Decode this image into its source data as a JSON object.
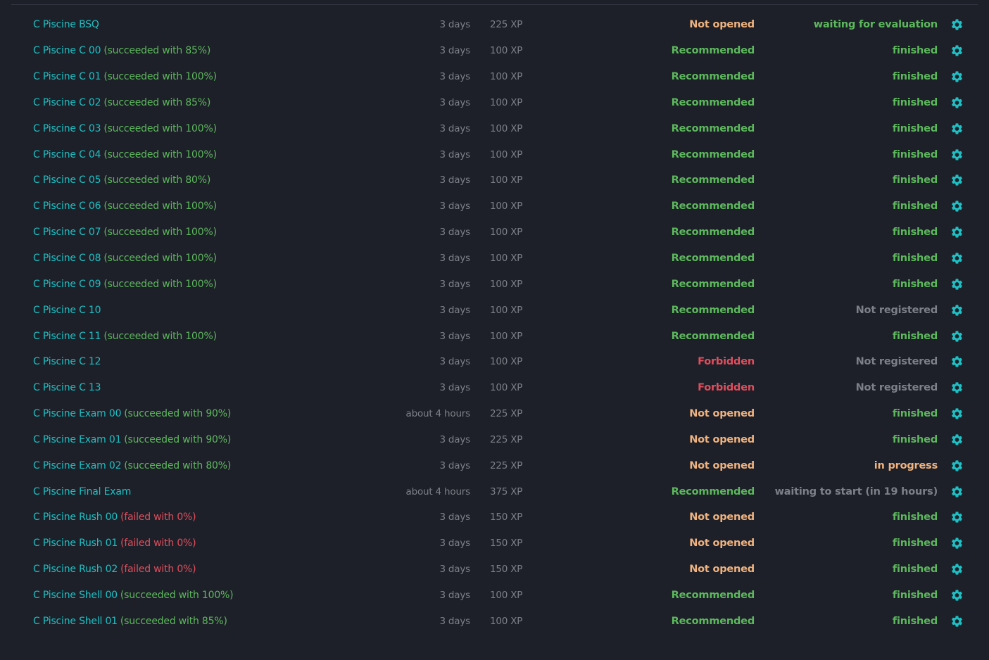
{
  "colors": {
    "background": "#1e2029",
    "link": "#1dc0c4",
    "success": "#5cb85c",
    "fail": "#e04e5c",
    "muted": "#7d8088",
    "not_opened": "#f0b37e",
    "recommended": "#5cb85c",
    "forbidden": "#e04e5c",
    "not_registered": "#7d8088",
    "in_progress": "#f0b37e",
    "waiting": "#7d8088"
  },
  "icons": {
    "settings": "gear-icon"
  },
  "projects": [
    {
      "name": "C Piscine BSQ",
      "result": "",
      "result_type": "none",
      "duration": "3 days",
      "xp": "225 XP",
      "availability": "Not opened",
      "availability_type": "not_opened",
      "status": "waiting for evaluation",
      "status_type": "success"
    },
    {
      "name": "C Piscine C 00",
      "result": "(succeeded with 85%)",
      "result_type": "success",
      "duration": "3 days",
      "xp": "100 XP",
      "availability": "Recommended",
      "availability_type": "recommended",
      "status": "finished",
      "status_type": "success"
    },
    {
      "name": "C Piscine C 01",
      "result": "(succeeded with 100%)",
      "result_type": "success",
      "duration": "3 days",
      "xp": "100 XP",
      "availability": "Recommended",
      "availability_type": "recommended",
      "status": "finished",
      "status_type": "success"
    },
    {
      "name": "C Piscine C 02",
      "result": "(succeeded with 85%)",
      "result_type": "success",
      "duration": "3 days",
      "xp": "100 XP",
      "availability": "Recommended",
      "availability_type": "recommended",
      "status": "finished",
      "status_type": "success"
    },
    {
      "name": "C Piscine C 03",
      "result": "(succeeded with 100%)",
      "result_type": "success",
      "duration": "3 days",
      "xp": "100 XP",
      "availability": "Recommended",
      "availability_type": "recommended",
      "status": "finished",
      "status_type": "success"
    },
    {
      "name": "C Piscine C 04",
      "result": "(succeeded with 100%)",
      "result_type": "success",
      "duration": "3 days",
      "xp": "100 XP",
      "availability": "Recommended",
      "availability_type": "recommended",
      "status": "finished",
      "status_type": "success"
    },
    {
      "name": "C Piscine C 05",
      "result": "(succeeded with 80%)",
      "result_type": "success",
      "duration": "3 days",
      "xp": "100 XP",
      "availability": "Recommended",
      "availability_type": "recommended",
      "status": "finished",
      "status_type": "success"
    },
    {
      "name": "C Piscine C 06",
      "result": "(succeeded with 100%)",
      "result_type": "success",
      "duration": "3 days",
      "xp": "100 XP",
      "availability": "Recommended",
      "availability_type": "recommended",
      "status": "finished",
      "status_type": "success"
    },
    {
      "name": "C Piscine C 07",
      "result": "(succeeded with 100%)",
      "result_type": "success",
      "duration": "3 days",
      "xp": "100 XP",
      "availability": "Recommended",
      "availability_type": "recommended",
      "status": "finished",
      "status_type": "success"
    },
    {
      "name": "C Piscine C 08",
      "result": "(succeeded with 100%)",
      "result_type": "success",
      "duration": "3 days",
      "xp": "100 XP",
      "availability": "Recommended",
      "availability_type": "recommended",
      "status": "finished",
      "status_type": "success"
    },
    {
      "name": "C Piscine C 09",
      "result": "(succeeded with 100%)",
      "result_type": "success",
      "duration": "3 days",
      "xp": "100 XP",
      "availability": "Recommended",
      "availability_type": "recommended",
      "status": "finished",
      "status_type": "success"
    },
    {
      "name": "C Piscine C 10",
      "result": "",
      "result_type": "none",
      "duration": "3 days",
      "xp": "100 XP",
      "availability": "Recommended",
      "availability_type": "recommended",
      "status": "Not registered",
      "status_type": "not_registered"
    },
    {
      "name": "C Piscine C 11",
      "result": "(succeeded with 100%)",
      "result_type": "success",
      "duration": "3 days",
      "xp": "100 XP",
      "availability": "Recommended",
      "availability_type": "recommended",
      "status": "finished",
      "status_type": "success"
    },
    {
      "name": "C Piscine C 12",
      "result": "",
      "result_type": "none",
      "duration": "3 days",
      "xp": "100 XP",
      "availability": "Forbidden",
      "availability_type": "forbidden",
      "status": "Not registered",
      "status_type": "not_registered"
    },
    {
      "name": "C Piscine C 13",
      "result": "",
      "result_type": "none",
      "duration": "3 days",
      "xp": "100 XP",
      "availability": "Forbidden",
      "availability_type": "forbidden",
      "status": "Not registered",
      "status_type": "not_registered"
    },
    {
      "name": "C Piscine Exam 00",
      "result": "(succeeded with 90%)",
      "result_type": "success",
      "duration": "about 4 hours",
      "xp": "225 XP",
      "availability": "Not opened",
      "availability_type": "not_opened",
      "status": "finished",
      "status_type": "success"
    },
    {
      "name": "C Piscine Exam 01",
      "result": "(succeeded with 90%)",
      "result_type": "success",
      "duration": "3 days",
      "xp": "225 XP",
      "availability": "Not opened",
      "availability_type": "not_opened",
      "status": "finished",
      "status_type": "success"
    },
    {
      "name": "C Piscine Exam 02",
      "result": "(succeeded with 80%)",
      "result_type": "success",
      "duration": "3 days",
      "xp": "225 XP",
      "availability": "Not opened",
      "availability_type": "not_opened",
      "status": "in progress",
      "status_type": "in_progress"
    },
    {
      "name": "C Piscine Final Exam",
      "result": "",
      "result_type": "none",
      "duration": "about 4 hours",
      "xp": "375 XP",
      "availability": "Recommended",
      "availability_type": "recommended",
      "status": "waiting to start (in 19 hours)",
      "status_type": "waiting"
    },
    {
      "name": "C Piscine Rush 00",
      "result": "(failed with 0%)",
      "result_type": "fail",
      "duration": "3 days",
      "xp": "150 XP",
      "availability": "Not opened",
      "availability_type": "not_opened",
      "status": "finished",
      "status_type": "success"
    },
    {
      "name": "C Piscine Rush 01",
      "result": "(failed with 0%)",
      "result_type": "fail",
      "duration": "3 days",
      "xp": "150 XP",
      "availability": "Not opened",
      "availability_type": "not_opened",
      "status": "finished",
      "status_type": "success"
    },
    {
      "name": "C Piscine Rush 02",
      "result": "(failed with 0%)",
      "result_type": "fail",
      "duration": "3 days",
      "xp": "150 XP",
      "availability": "Not opened",
      "availability_type": "not_opened",
      "status": "finished",
      "status_type": "success"
    },
    {
      "name": "C Piscine Shell 00",
      "result": "(succeeded with 100%)",
      "result_type": "success",
      "duration": "3 days",
      "xp": "100 XP",
      "availability": "Recommended",
      "availability_type": "recommended",
      "status": "finished",
      "status_type": "success"
    },
    {
      "name": "C Piscine Shell 01",
      "result": "(succeeded with 85%)",
      "result_type": "success",
      "duration": "3 days",
      "xp": "100 XP",
      "availability": "Recommended",
      "availability_type": "recommended",
      "status": "finished",
      "status_type": "success"
    }
  ]
}
